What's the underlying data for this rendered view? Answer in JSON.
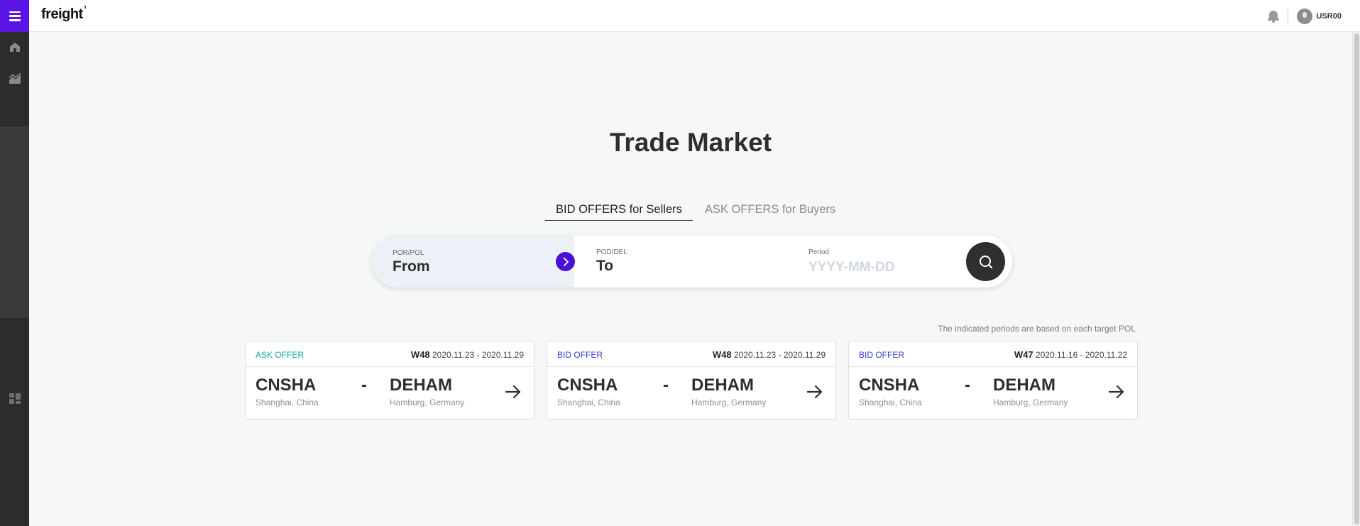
{
  "header": {
    "logo": "freight",
    "user_name": "USR00"
  },
  "icons": {
    "menu": "menu-icon",
    "home": "home-icon",
    "chart": "chart-icon",
    "dashboard": "dashboard-icon",
    "bell": "bell-icon",
    "avatar": "user-avatar-icon",
    "arrow_right": "chevron-right-icon",
    "search": "search-icon",
    "go": "arrow-right-icon"
  },
  "colors": {
    "brand": "#5a14e6",
    "ask": "#12a89a",
    "bid": "#3a3fd8",
    "sidebar": "#2c2c2c"
  },
  "main": {
    "title": "Trade Market",
    "tabs": [
      {
        "label": "BID OFFERS for Sellers",
        "active": true
      },
      {
        "label": "ASK OFFERS for Buyers",
        "active": false
      }
    ],
    "search": {
      "from_label": "POR/POL",
      "from_value": "From",
      "to_label": "POD/DEL",
      "to_value": "To",
      "period_label": "Period",
      "period_placeholder": "YYYY-MM-DD"
    },
    "note": "The indicated periods are based on each target POL",
    "cards": [
      {
        "type": "ASK OFFER",
        "week": "W48",
        "range": "2020.11.23 - 2020.11.29",
        "from_code": "CNSHA",
        "from_city": "Shanghai, China",
        "to_code": "DEHAM",
        "to_city": "Hamburg, Germany",
        "separator": "-"
      },
      {
        "type": "BID OFFER",
        "week": "W48",
        "range": "2020.11.23 - 2020.11.29",
        "from_code": "CNSHA",
        "from_city": "Shanghai, China",
        "to_code": "DEHAM",
        "to_city": "Hamburg, Germany",
        "separator": "-"
      },
      {
        "type": "BID OFFER",
        "week": "W47",
        "range": "2020.11.16 - 2020.11.22",
        "from_code": "CNSHA",
        "from_city": "Shanghai, China",
        "to_code": "DEHAM",
        "to_city": "Hamburg, Germany",
        "separator": "-"
      }
    ]
  }
}
